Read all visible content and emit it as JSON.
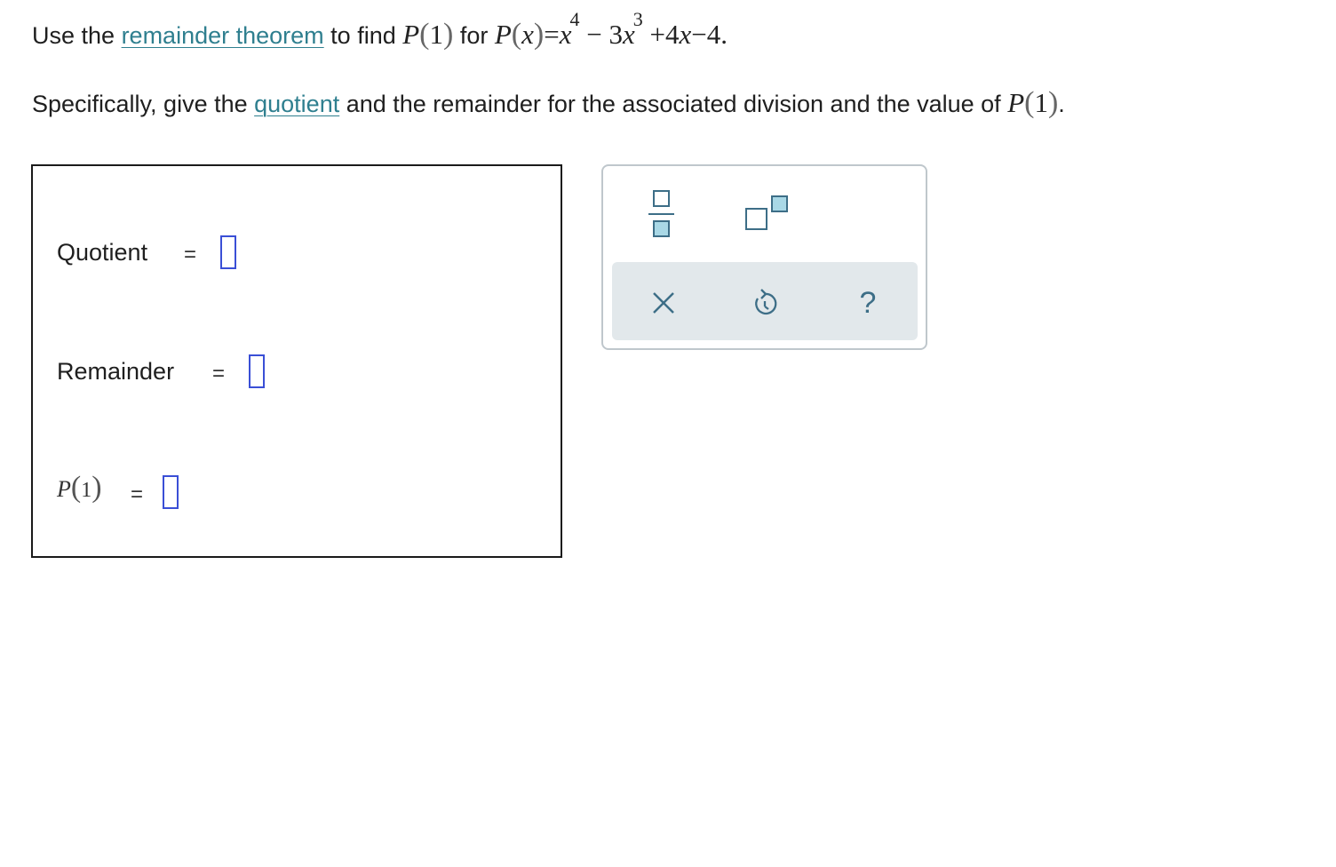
{
  "question": {
    "line1": {
      "prefix": "Use the ",
      "link_text": "remainder theorem",
      "middle": " to find ",
      "P": "P",
      "arg": "1",
      "for_text": " for ",
      "P2": "P",
      "x": "x",
      "equals": "=",
      "term1_base": "x",
      "term1_exp": "4",
      "minus1": "−",
      "term2_coef": "3",
      "term2_base": "x",
      "term2_exp": "3",
      "plus": "+",
      "term3_coef": "4",
      "term3_base": "x",
      "minus2": "−",
      "const": "4",
      "period": "."
    },
    "line2": {
      "prefix": "Specifically, give the ",
      "link_text": "quotient",
      "suffix": " and the remainder for the associated division and the value of ",
      "P": "P",
      "arg": "1",
      "period": "."
    }
  },
  "answers": {
    "quotient_label": "Quotient",
    "remainder_label": "Remainder",
    "p_label": "P",
    "p_arg": "1",
    "equals": "=",
    "quotient_value": "",
    "remainder_value": "",
    "p_value": ""
  },
  "toolbar": {
    "fraction_icon": "fraction-icon",
    "exponent_icon": "exponent-icon",
    "clear_icon": "close-icon",
    "undo_icon": "undo-icon",
    "help_glyph": "?"
  },
  "colors": {
    "link": "#2f7f8f",
    "slot_border": "#3a4fd6",
    "toolbar_icon": "#3d6e87",
    "toolbar_fill": "#a9d8e6",
    "action_bar_bg": "#e2e8eb"
  }
}
